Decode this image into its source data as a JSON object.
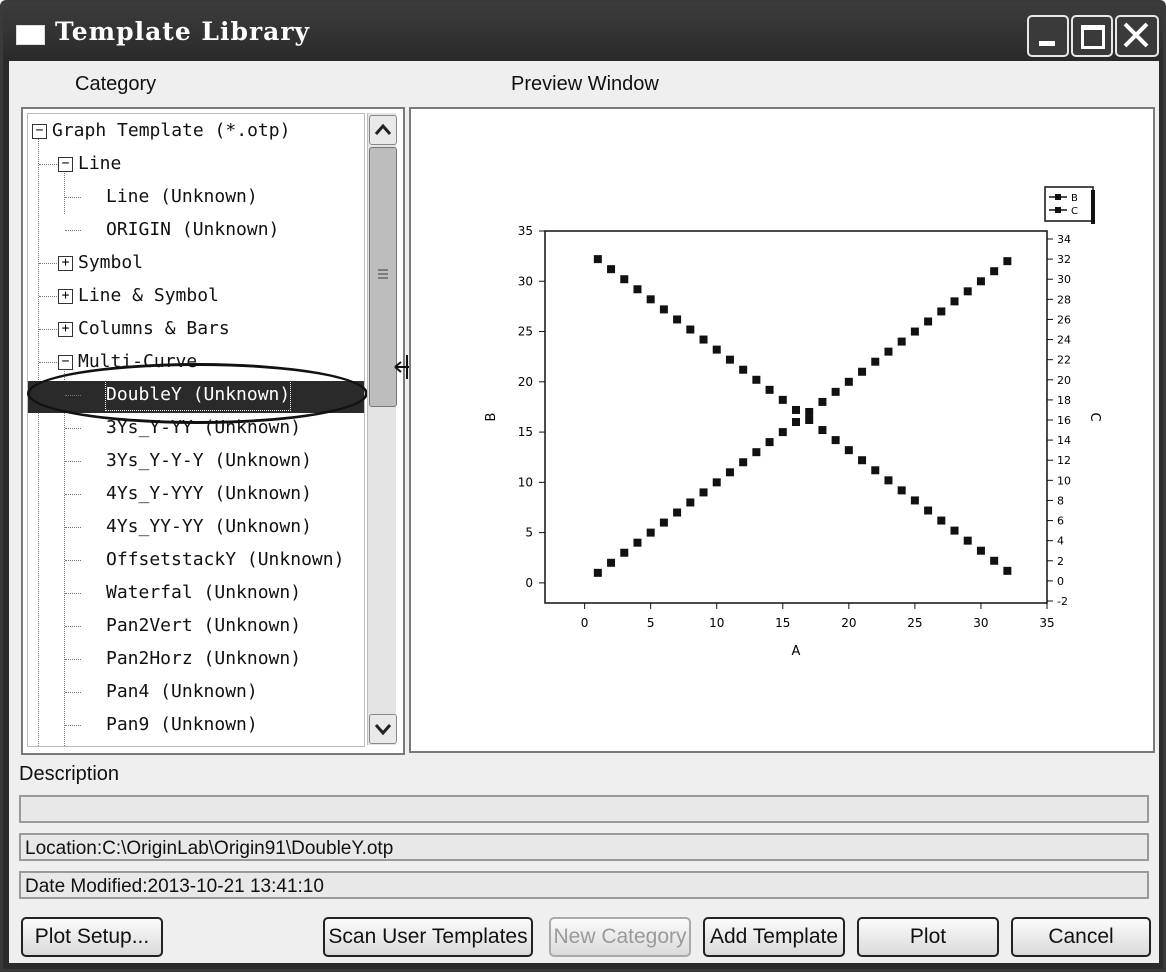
{
  "window": {
    "title": "Template Library"
  },
  "labels": {
    "category": "Category",
    "preview": "Preview Window",
    "description": "Description"
  },
  "tree": {
    "items": [
      {
        "text": "Graph Template (*.otp)",
        "level": 0,
        "expander": "−"
      },
      {
        "text": "Line",
        "level": 1,
        "expander": "−"
      },
      {
        "text": "Line (Unknown)",
        "level": 2
      },
      {
        "text": "ORIGIN (Unknown)",
        "level": 2
      },
      {
        "text": "Symbol",
        "level": 1,
        "expander": "+"
      },
      {
        "text": "Line & Symbol",
        "level": 1,
        "expander": "+"
      },
      {
        "text": "Columns & Bars",
        "level": 1,
        "expander": "+"
      },
      {
        "text": "Multi-Curve",
        "level": 1,
        "expander": "−"
      },
      {
        "text": "DoubleY (Unknown)",
        "level": 2,
        "selected": true
      },
      {
        "text": "3Ys_Y-YY (Unknown)",
        "level": 2
      },
      {
        "text": "3Ys_Y-Y-Y (Unknown)",
        "level": 2
      },
      {
        "text": "4Ys_Y-YYY (Unknown)",
        "level": 2
      },
      {
        "text": "4Ys_YY-YY (Unknown)",
        "level": 2
      },
      {
        "text": "OffsetstackY (Unknown)",
        "level": 2
      },
      {
        "text": "Waterfal (Unknown)",
        "level": 2
      },
      {
        "text": "Pan2Vert (Unknown)",
        "level": 2
      },
      {
        "text": "Pan2Horz (Unknown)",
        "level": 2
      },
      {
        "text": "Pan4 (Unknown)",
        "level": 2
      },
      {
        "text": "Pan9 (Unknown)",
        "level": 2
      }
    ]
  },
  "info": {
    "description": "",
    "location": "Location:C:\\OriginLab\\Origin91\\DoubleY.otp",
    "date_modified": "Date Modified:2013-10-21 13:41:10"
  },
  "buttons": {
    "plot_setup": "Plot Setup...",
    "scan": "Scan User Templates",
    "new_category": "New Category",
    "add_template": "Add Template",
    "plot": "Plot",
    "cancel": "Cancel"
  },
  "chart_data": {
    "type": "scatter",
    "xlabel": "A",
    "ylabel": "B",
    "y2label": "C",
    "xlim": [
      -3,
      35
    ],
    "ylim": [
      -2,
      35
    ],
    "y2lim": [
      -2,
      34
    ],
    "xticks": [
      0,
      5,
      10,
      15,
      20,
      25,
      30,
      35
    ],
    "yticks": [
      0,
      5,
      10,
      15,
      20,
      25,
      30,
      35
    ],
    "y2ticks": [
      -2,
      0,
      2,
      4,
      6,
      8,
      10,
      12,
      14,
      16,
      18,
      20,
      22,
      24,
      26,
      28,
      30,
      32,
      34
    ],
    "legend": [
      "B",
      "C"
    ],
    "legend_position": "top-right",
    "series": [
      {
        "name": "B",
        "axis": "left",
        "x": [
          1,
          2,
          3,
          4,
          5,
          6,
          7,
          8,
          9,
          10,
          11,
          12,
          13,
          14,
          15,
          16,
          17,
          18,
          19,
          20,
          21,
          22,
          23,
          24,
          25,
          26,
          27,
          28,
          29,
          30,
          31,
          32
        ],
        "y": [
          1,
          2,
          3,
          4,
          5,
          6,
          7,
          8,
          9,
          10,
          11,
          12,
          13,
          14,
          15,
          16,
          17,
          18,
          19,
          20,
          21,
          22,
          23,
          24,
          25,
          26,
          27,
          28,
          29,
          30,
          31,
          32
        ]
      },
      {
        "name": "C",
        "axis": "right",
        "x": [
          1,
          2,
          3,
          4,
          5,
          6,
          7,
          8,
          9,
          10,
          11,
          12,
          13,
          14,
          15,
          16,
          17,
          18,
          19,
          20,
          21,
          22,
          23,
          24,
          25,
          26,
          27,
          28,
          29,
          30,
          31,
          32
        ],
        "y": [
          32,
          31,
          30,
          29,
          28,
          27,
          26,
          25,
          24,
          23,
          22,
          21,
          20,
          19,
          18,
          17,
          16,
          15,
          14,
          13,
          12,
          11,
          10,
          9,
          8,
          7,
          6,
          5,
          4,
          3,
          2,
          1
        ]
      }
    ]
  }
}
